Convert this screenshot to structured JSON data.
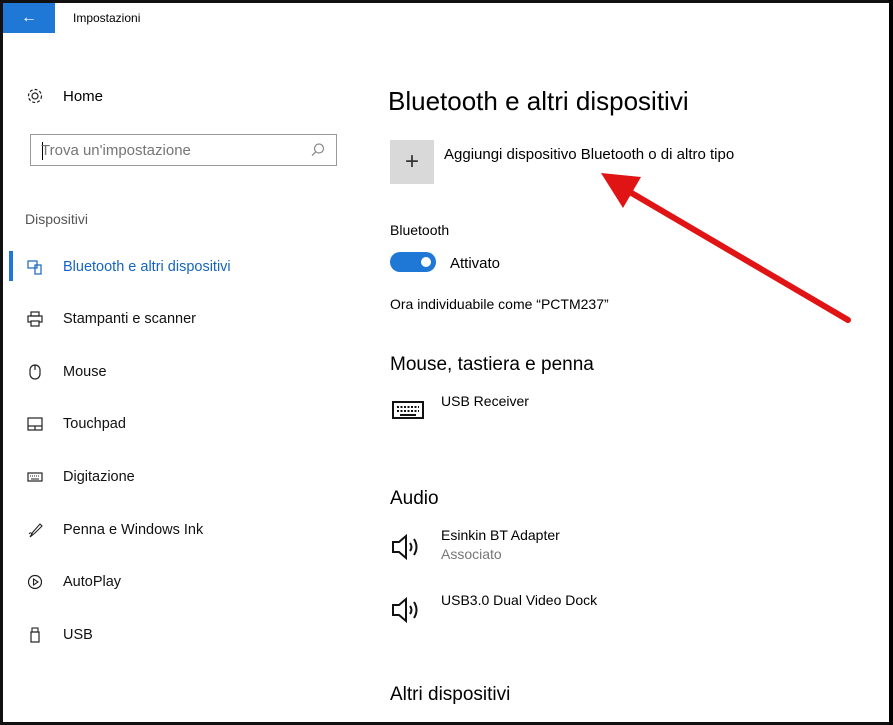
{
  "window": {
    "title": "Impostazioni",
    "back_icon": "arrow-left-icon",
    "accent": "#1f77d6"
  },
  "sidebar": {
    "home_label": "Home",
    "search_placeholder": "Trova un'impostazione",
    "section_label": "Dispositivi",
    "items": [
      {
        "label": "Bluetooth e altri dispositivi",
        "icon": "bluetooth-devices-icon",
        "active": true
      },
      {
        "label": "Stampanti e scanner",
        "icon": "printer-icon",
        "active": false
      },
      {
        "label": "Mouse",
        "icon": "mouse-icon",
        "active": false
      },
      {
        "label": "Touchpad",
        "icon": "touchpad-icon",
        "active": false
      },
      {
        "label": "Digitazione",
        "icon": "keyboard-icon",
        "active": false
      },
      {
        "label": "Penna e Windows Ink",
        "icon": "pen-icon",
        "active": false
      },
      {
        "label": "AutoPlay",
        "icon": "autoplay-icon",
        "active": false
      },
      {
        "label": "USB",
        "icon": "usb-icon",
        "active": false
      }
    ]
  },
  "main": {
    "title": "Bluetooth e altri dispositivi",
    "add_device_label": "Aggiungi dispositivo Bluetooth o di altro tipo",
    "bluetooth_label": "Bluetooth",
    "toggle_state": "Attivato",
    "discoverable_text": "Ora individuabile come “PCTM237”",
    "groups": {
      "input": {
        "title": "Mouse, tastiera e penna",
        "devices": [
          {
            "name": "USB Receiver",
            "icon": "keyboard-icon"
          }
        ]
      },
      "audio": {
        "title": "Audio",
        "devices": [
          {
            "name": "Esinkin BT Adapter",
            "status": "Associato",
            "icon": "speaker-icon"
          },
          {
            "name": "USB3.0 Dual Video Dock",
            "icon": "speaker-icon"
          }
        ]
      },
      "other": {
        "title": "Altri dispositivi"
      }
    }
  },
  "annotation": {
    "arrow_color": "#e01414",
    "icon": "red-arrow-annotation"
  }
}
